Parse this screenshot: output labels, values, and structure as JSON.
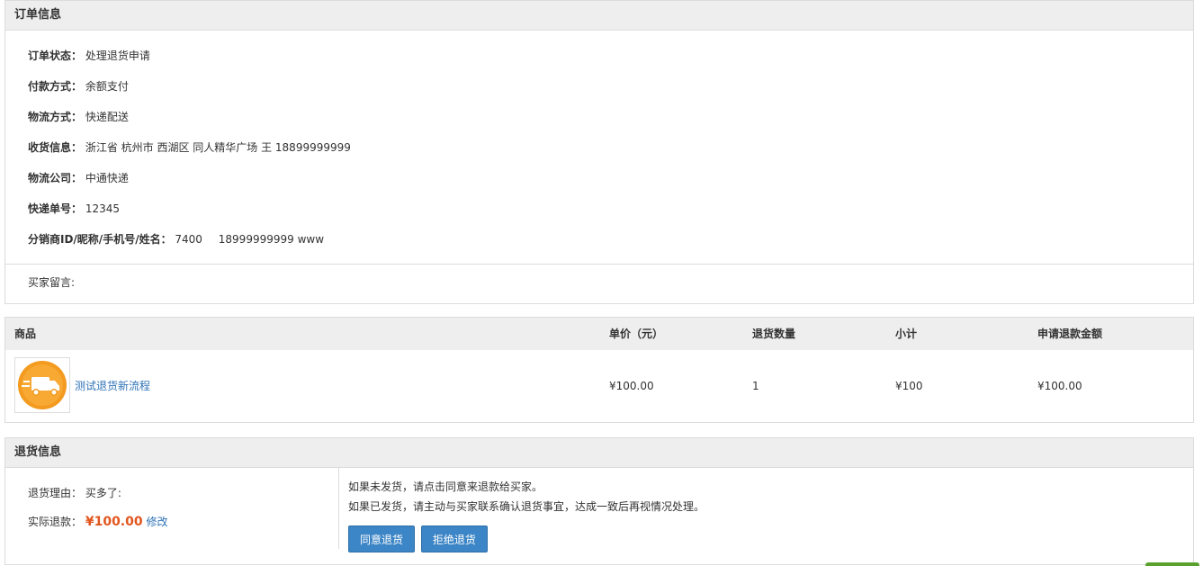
{
  "order_info": {
    "title": "订单信息",
    "rows": [
      {
        "label": "订单状态：",
        "value": "处理退货申请"
      },
      {
        "label": "付款方式：",
        "value": "余额支付"
      },
      {
        "label": "物流方式：",
        "value": "快递配送"
      },
      {
        "label": "收货信息：",
        "value": "浙江省 杭州市 西湖区 同人精华广场 王 18899999999"
      },
      {
        "label": "物流公司：",
        "value": "中通快递"
      },
      {
        "label": "快递单号：",
        "value": "12345"
      }
    ],
    "distributor": {
      "label": "分销商ID/昵称/手机号/姓名：",
      "id": "7400",
      "phone": "18999999999",
      "name": "www"
    },
    "buyer_message": "买家留言:"
  },
  "goods": {
    "headers": {
      "product": "商品",
      "unit_price": "单价（元）",
      "qty": "退货数量",
      "subtotal": "小计",
      "refund": "申请退款金额"
    },
    "item": {
      "icon": "delivery-truck-icon",
      "name": "测试退货新流程",
      "unit_price": "¥100.00",
      "qty": "1",
      "subtotal": "¥100",
      "refund": "¥100.00"
    }
  },
  "return_info": {
    "title": "退货信息",
    "reason_label": "退货理由：",
    "reason_value": "买多了:",
    "actual_label": "实际退款：",
    "actual_value": "¥100.00",
    "modify_link": "修改",
    "note_1": "如果未发货，请点击同意来退款给买家。",
    "note_2": "如果已发货，请主动与买家联系确认退货事宜，达成一致后再视情况处理。",
    "agree_button": "同意退货",
    "reject_button": "拒绝退货"
  },
  "colors": {
    "accent": "#3c85c6",
    "price": "#e2561f",
    "link": "#2f73b7",
    "icon": "#f39a1f"
  }
}
